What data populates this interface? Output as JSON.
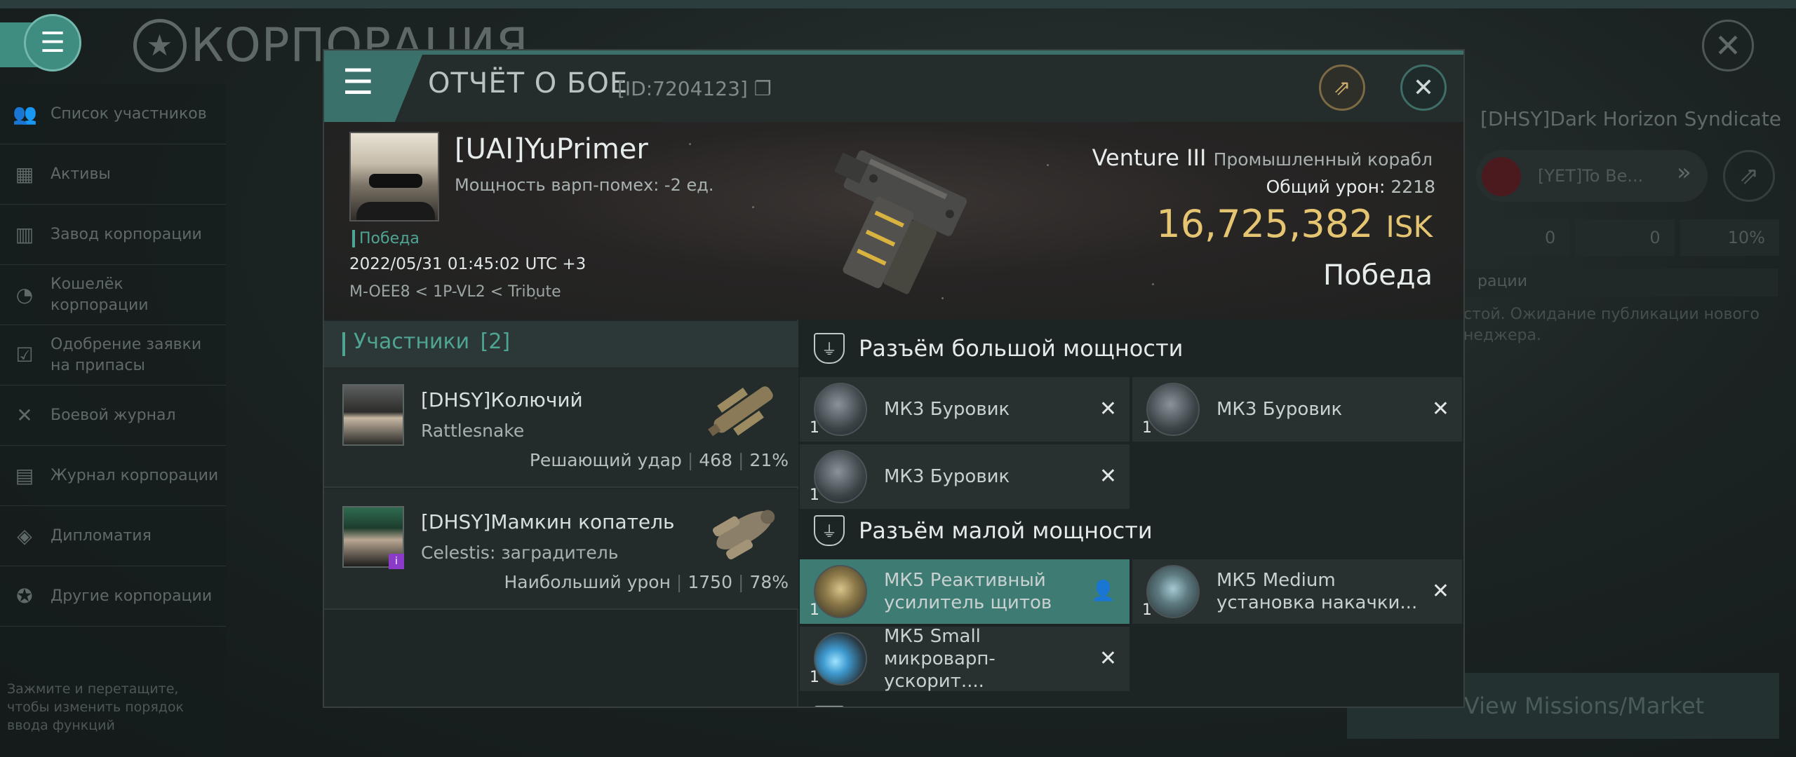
{
  "background": {
    "corp_title": "КОРПОРАЦИЯ",
    "sidebar": [
      {
        "label": "Список участников",
        "icon": "people-icon"
      },
      {
        "label": "Активы",
        "icon": "boxes-icon"
      },
      {
        "label": "Завод корпорации",
        "icon": "factory-icon"
      },
      {
        "label": "Кошелёк корпорации",
        "icon": "wallet-icon"
      },
      {
        "label": "Одобрение заявки на припасы",
        "icon": "approval-icon"
      },
      {
        "label": "Боевой журнал",
        "icon": "crossed-swords-icon"
      },
      {
        "label": "Журнал корпорации",
        "icon": "journal-icon"
      },
      {
        "label": "Дипломатия",
        "icon": "handshake-icon"
      },
      {
        "label": "Другие корпорации",
        "icon": "star-icon"
      }
    ],
    "sidebar_hint": "Зажмите и перетащите, чтобы изменить порядок ввода функций",
    "right_panel": {
      "corp_name": "[DHSY]Dark Horizon Syndicate",
      "pill_text": "[YET]To Be...",
      "stats": [
        "0",
        "0",
        "10%"
      ],
      "section_label": "рации",
      "text": "стой. Ожидание публикации нового неджера.",
      "button_label": "View Missions/Market"
    }
  },
  "modal": {
    "title": "ОТЧЁТ О БОЕ",
    "report_id": "[ID:7204123]",
    "victim": {
      "name": "[UAI]YuPrimer",
      "warp": "Мощность варп-помех: -2 ед.",
      "tag": "Победа",
      "date": "2022/05/31 01:45:02 UTC +3",
      "location": "M-OEE8 < 1P-VL2 < Tribute",
      "ship_name": "Venture III",
      "ship_class": "Промышленный корабл",
      "total_damage_label": "Общий урон:",
      "total_damage_value": "2218",
      "isk_value": "16,725,382",
      "isk_unit": "ISK",
      "result": "Победа"
    },
    "participants": {
      "header": "Участники",
      "count": "[2]",
      "list": [
        {
          "name": "[DHSY]Колючий",
          "ship": "Rattlesnake",
          "stat_label": "Решающий удар",
          "damage": "468",
          "percent": "21%"
        },
        {
          "name": "[DHSY]Мамкин копатель",
          "ship": "Celestis: заградитель",
          "stat_label": "Наибольший урон",
          "damage": "1750",
          "percent": "78%"
        }
      ]
    },
    "high_slot": {
      "title": "Разъём большой мощности",
      "modules": [
        {
          "name": "МК3 Буровик",
          "qty": "1"
        },
        {
          "name": "МК3 Буровик",
          "qty": "1"
        },
        {
          "name": "МК3 Буровик",
          "qty": "1"
        }
      ]
    },
    "low_slot": {
      "title": "Разъём малой мощности",
      "modules": [
        {
          "name": "МК5 Реактивный усилитель щитов",
          "qty": "1"
        },
        {
          "name": "МК5 Medium установка накачки...",
          "qty": "1"
        },
        {
          "name": "МК5 Small микроварп-ускорит....",
          "qty": "1"
        }
      ]
    }
  }
}
